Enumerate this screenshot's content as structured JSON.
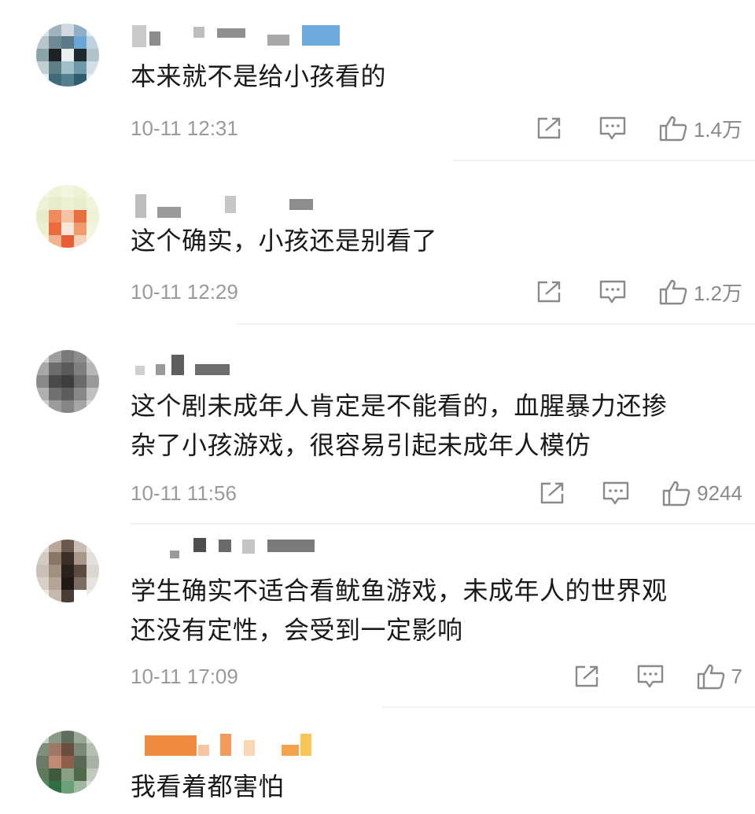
{
  "comments": [
    {
      "text": "本来就不是给小孩看的",
      "time": "10-11 12:31",
      "likes": "1.4万",
      "share_icon": "share-icon",
      "reply_icon": "comment-reply-icon",
      "like_icon": "thumbs-up-icon"
    },
    {
      "text": "这个确实，小孩还是别看了",
      "time": "10-11 12:29",
      "likes": "1.2万",
      "share_icon": "share-icon",
      "reply_icon": "comment-reply-icon",
      "like_icon": "thumbs-up-icon"
    },
    {
      "text": "这个剧未成年人肯定是不能看的，血腥暴力还掺\n杂了小孩游戏，很容易引起未成年人模仿",
      "time": "10-11 11:56",
      "likes": "9244",
      "share_icon": "share-icon",
      "reply_icon": "comment-reply-icon",
      "like_icon": "thumbs-up-icon"
    },
    {
      "text": "学生确实不适合看鱿鱼游戏，未成年人的世界观\n还没有定性，会受到一定影响",
      "time": "10-11 17:09",
      "likes": "7",
      "share_icon": "share-icon",
      "reply_icon": "comment-reply-icon",
      "like_icon": "thumbs-up-icon"
    },
    {
      "text": "我看着都害怕"
    }
  ],
  "colors": {
    "text": "#1a1a1a",
    "meta": "#9a9a9a",
    "icon": "#8a8a8a",
    "divider": "#f0f0f0"
  }
}
